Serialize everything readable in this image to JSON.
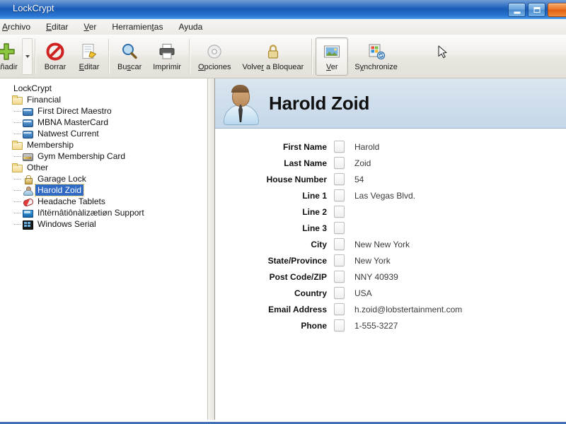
{
  "window": {
    "title": "LockCrypt",
    "controls": [
      {
        "name": "minimize",
        "glyph": "minimize-icon"
      },
      {
        "name": "maximize",
        "glyph": "maximize-icon"
      },
      {
        "name": "close",
        "glyph": "close-icon"
      }
    ]
  },
  "menubar": {
    "items": [
      {
        "label": "Archivo",
        "mnemonic": "A"
      },
      {
        "label": "Editar",
        "mnemonic": "E"
      },
      {
        "label": "Ver",
        "mnemonic": "V"
      },
      {
        "label": "Herramientas",
        "mnemonic": "t"
      },
      {
        "label": "Ayuda",
        "mnemonic": "A"
      }
    ]
  },
  "toolbar": {
    "buttons": [
      {
        "label": "Añadir",
        "icon": "plus-icon",
        "active": false,
        "has_dropdown": true
      },
      {
        "label": "Borrar",
        "icon": "delete-icon",
        "active": false
      },
      {
        "label": "Editar",
        "icon": "edit-icon",
        "active": false
      },
      {
        "label": "Buscar",
        "icon": "search-icon",
        "active": false
      },
      {
        "label": "Imprimir",
        "icon": "printer-icon",
        "active": false
      },
      {
        "label": "Opciones",
        "icon": "gear-icon",
        "active": false
      },
      {
        "label": "Volver a Bloquear",
        "icon": "lock-icon",
        "active": false
      },
      {
        "label": "Ver",
        "icon": "view-image-icon",
        "active": true
      },
      {
        "label": "Synchronize",
        "icon": "synchronize-icon",
        "active": false
      }
    ]
  },
  "tree": {
    "root_label": "LockCrypt",
    "nodes": [
      {
        "label": "LockCrypt",
        "level": 0,
        "icon": "none",
        "selected": false
      },
      {
        "label": "Financial",
        "level": 1,
        "icon": "folder",
        "selected": false
      },
      {
        "label": "First Direct Maestro",
        "level": 2,
        "icon": "card",
        "selected": false
      },
      {
        "label": "MBNA MasterCard",
        "level": 2,
        "icon": "card",
        "selected": false
      },
      {
        "label": "Natwest Current",
        "level": 2,
        "icon": "card",
        "selected": false
      },
      {
        "label": "Membership",
        "level": 1,
        "icon": "folder",
        "selected": false
      },
      {
        "label": "Gym Membership Card",
        "level": 2,
        "icon": "gym",
        "selected": false
      },
      {
        "label": "Other",
        "level": 1,
        "icon": "folder",
        "selected": false
      },
      {
        "label": "Garage Lock",
        "level": 2,
        "icon": "lock",
        "selected": false
      },
      {
        "label": "Harold Zoid",
        "level": 2,
        "icon": "person",
        "selected": true
      },
      {
        "label": "Headache Tablets",
        "level": 2,
        "icon": "pill",
        "selected": false
      },
      {
        "label": "Iñtërnâtiônàlizætiøn Support",
        "level": 2,
        "icon": "globe",
        "selected": false
      },
      {
        "label": "Windows Serial",
        "level": 2,
        "icon": "winkey",
        "selected": false
      }
    ]
  },
  "detail": {
    "title": "Harold Zoid",
    "avatar": "person-avatar-icon",
    "fields": [
      {
        "label": "First Name",
        "value": "Harold"
      },
      {
        "label": "Last Name",
        "value": "Zoid"
      },
      {
        "label": "House Number",
        "value": "54"
      },
      {
        "label": "Line 1",
        "value": "Las Vegas Blvd."
      },
      {
        "label": "Line 2",
        "value": ""
      },
      {
        "label": "Line 3",
        "value": ""
      },
      {
        "label": "City",
        "value": "New New York"
      },
      {
        "label": "State/Province",
        "value": "New York"
      },
      {
        "label": "Post Code/ZIP",
        "value": "NNY 40939"
      },
      {
        "label": "Country",
        "value": "USA"
      },
      {
        "label": "Email Address",
        "value": "h.zoid@lobstertainment.com"
      },
      {
        "label": "Phone",
        "value": "1-555-3227"
      }
    ]
  },
  "colors": {
    "titlebar_blue": "#1f62bd",
    "selection_blue": "#316ac5",
    "header_panel": "#cfdeec",
    "bottom_border": "#3f6fb5"
  }
}
